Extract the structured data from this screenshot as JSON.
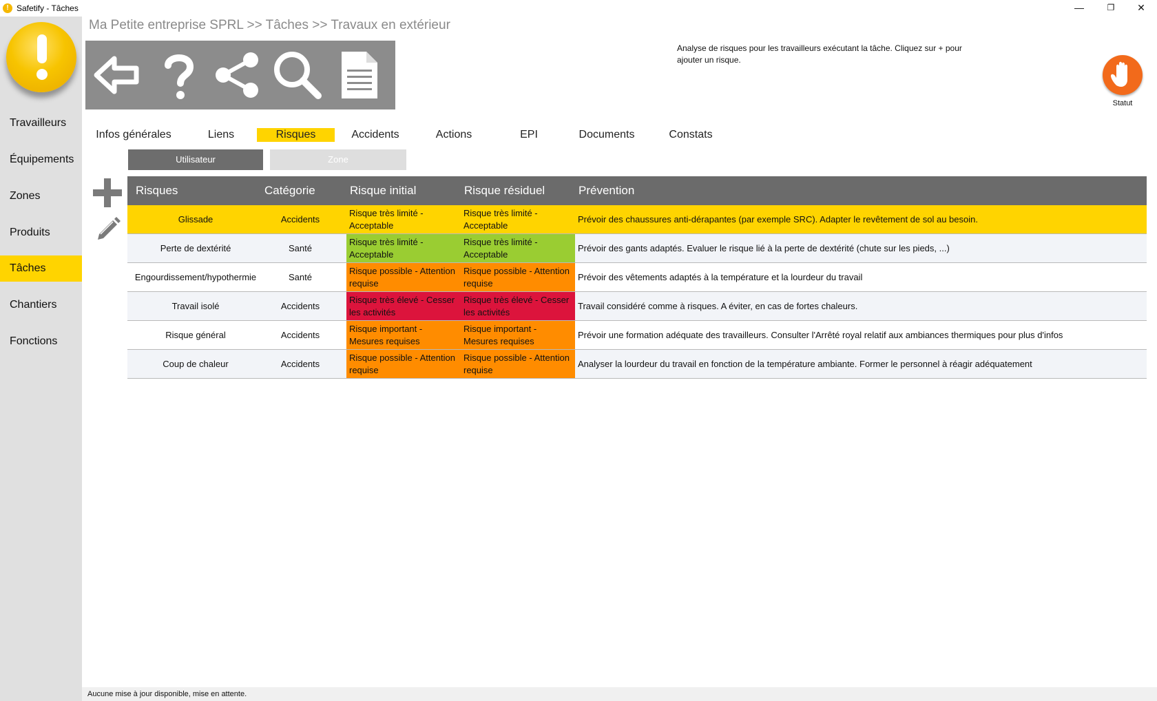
{
  "window": {
    "title": "Safetify - Tâches",
    "min": "—",
    "restore": "❐",
    "close": "✕"
  },
  "colors": {
    "accent": "#ffd400",
    "green": "#9acd32",
    "orange": "#ff8c00",
    "red": "#dc143c",
    "status": "#f26a1b"
  },
  "sidebar": {
    "items": [
      {
        "label": "Travailleurs",
        "active": false
      },
      {
        "label": "Équipements",
        "active": false
      },
      {
        "label": "Zones",
        "active": false
      },
      {
        "label": "Produits",
        "active": false
      },
      {
        "label": "Tâches",
        "active": true
      },
      {
        "label": "Chantiers",
        "active": false
      },
      {
        "label": "Fonctions",
        "active": false
      }
    ]
  },
  "breadcrumb": "Ma Petite entreprise SPRL >> Tâches >> Travaux en extérieur",
  "toolbar": {
    "icons": [
      "back-arrow-icon",
      "help-icon",
      "share-icon",
      "search-icon",
      "document-icon"
    ]
  },
  "hint": "Analyse de risques pour les travailleurs exécutant la tâche. Cliquez sur + pour ajouter un risque.",
  "status": {
    "label": "Statut",
    "icon": "stop-hand-icon"
  },
  "tabs": [
    {
      "label": "Infos générales"
    },
    {
      "label": "Liens"
    },
    {
      "label": "Risques",
      "active": true
    },
    {
      "label": "Accidents"
    },
    {
      "label": "Actions"
    },
    {
      "label": "EPI"
    },
    {
      "label": "Documents"
    },
    {
      "label": "Constats"
    }
  ],
  "subtabs": {
    "user": "Utilisateur",
    "zone": "Zone"
  },
  "table": {
    "headers": {
      "risk": "Risques",
      "category": "Catégorie",
      "initial": "Risque initial",
      "residual": "Risque résiduel",
      "prevention": "Prévention"
    },
    "rows": [
      {
        "risk": "Glissade",
        "category": "Accidents",
        "initial": "Risque très limité - Acceptable",
        "initial_level": "none",
        "residual": "Risque très limité - Acceptable",
        "residual_level": "none",
        "prevention": "Prévoir des chaussures anti-dérapantes (par exemple SRC). Adapter le revêtement de sol au besoin."
      },
      {
        "risk": "Perte de dextérité",
        "category": "Santé",
        "initial": "Risque très limité - Acceptable",
        "initial_level": "green",
        "residual": "Risque très limité - Acceptable",
        "residual_level": "green",
        "prevention": "Prévoir des gants adaptés. Evaluer le risque lié à la perte de dextérité (chute sur les pieds, ...)"
      },
      {
        "risk": "Engourdissement/hypothermie",
        "category": "Santé",
        "initial": "Risque possible - Attention requise",
        "initial_level": "orange",
        "residual": "Risque possible - Attention requise",
        "residual_level": "orange",
        "prevention": "Prévoir des vêtements adaptés à la température et la lourdeur du travail"
      },
      {
        "risk": "Travail isolé",
        "category": "Accidents",
        "initial": "Risque très élevé - Cesser les activités",
        "initial_level": "red",
        "residual": "Risque très élevé - Cesser les activités",
        "residual_level": "red",
        "prevention": "Travail considéré comme à risques. A éviter, en cas de fortes chaleurs."
      },
      {
        "risk": "Risque général",
        "category": "Accidents",
        "initial": "Risque important - Mesures requises",
        "initial_level": "orange",
        "residual": "Risque important - Mesures requises",
        "residual_level": "orange",
        "prevention": "Prévoir une formation adéquate des travailleurs. Consulter l'Arrêté royal relatif aux ambiances thermiques pour plus d'infos"
      },
      {
        "risk": "Coup de chaleur",
        "category": "Accidents",
        "initial": "Risque possible - Attention requise",
        "initial_level": "orange",
        "residual": "Risque possible - Attention requise",
        "residual_level": "orange",
        "prevention": "Analyser la lourdeur du travail en fonction de la température ambiante. Former le personnel à réagir adéquatement"
      }
    ]
  },
  "statusbar": "Aucune mise à jour disponible, mise en attente."
}
